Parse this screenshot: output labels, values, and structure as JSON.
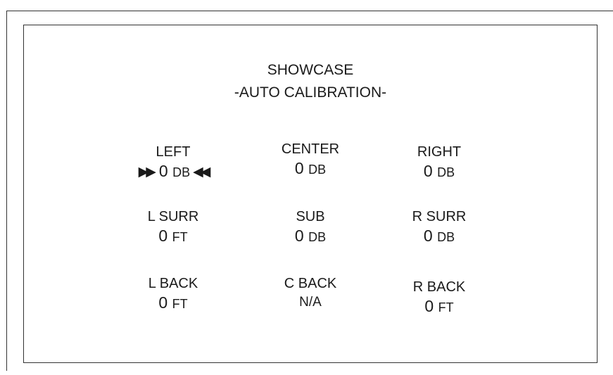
{
  "header": {
    "title": "SHOWCASE",
    "subtitle": "-AUTO CALIBRATION-"
  },
  "speakers": {
    "left": {
      "label": "LEFT",
      "value": "0",
      "unit": "DB",
      "selected": true
    },
    "center": {
      "label": "CENTER",
      "value": "0",
      "unit": "DB"
    },
    "right": {
      "label": "RIGHT",
      "value": "0",
      "unit": "DB"
    },
    "l_surr": {
      "label": "L SURR",
      "value": "0",
      "unit": "FT"
    },
    "sub": {
      "label": "SUB",
      "value": "0",
      "unit": "DB"
    },
    "r_surr": {
      "label": "R SURR",
      "value": "0",
      "unit": "DB"
    },
    "l_back": {
      "label": "L BACK",
      "value": "0",
      "unit": "FT"
    },
    "c_back": {
      "label": "C BACK",
      "value": "N/A"
    },
    "r_back": {
      "label": "R BACK",
      "value": "0",
      "unit": "FT"
    }
  },
  "selection_markers": {
    "before": "▶▶",
    "after": "◀◀"
  }
}
